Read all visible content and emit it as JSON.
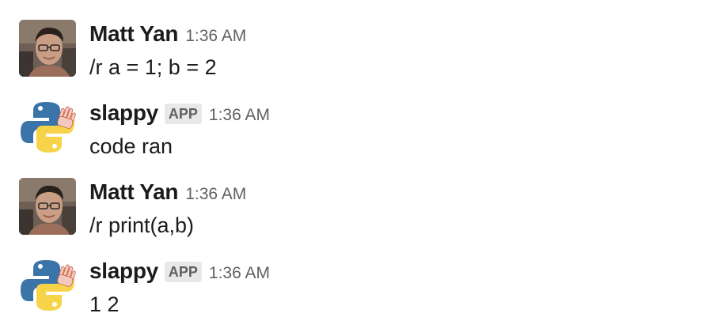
{
  "messages": [
    {
      "author": "Matt Yan",
      "badge": "",
      "time": "1:36 AM",
      "text": "/r a = 1; b = 2",
      "avatar": "user-photo-avatar"
    },
    {
      "author": "slappy",
      "badge": "APP",
      "time": "1:36 AM",
      "text": "code ran",
      "avatar": "python-logo-avatar"
    },
    {
      "author": "Matt Yan",
      "badge": "",
      "time": "1:36 AM",
      "text": "/r print(a,b)",
      "avatar": "user-photo-avatar"
    },
    {
      "author": "slappy",
      "badge": "APP",
      "time": "1:36 AM",
      "text": "1 2",
      "avatar": "python-logo-avatar"
    }
  ],
  "colors": {
    "text": "#1d1c1d",
    "muted": "#616061",
    "badge_bg": "#e8e8e8",
    "python_blue": "#3a74a8",
    "python_yellow": "#f7d34a"
  }
}
